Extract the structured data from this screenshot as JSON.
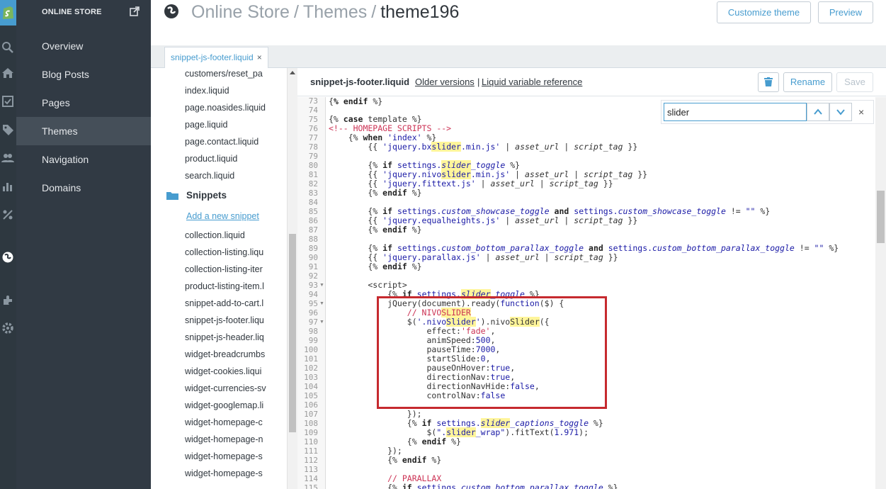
{
  "colors": {
    "accent": "#479ccf",
    "nav_bg": "#313a44",
    "rail_bg": "#2e3840",
    "highlight_box": "#c62a2f"
  },
  "nav": {
    "store_label": "ONLINE STORE",
    "items": [
      {
        "label": "Overview"
      },
      {
        "label": "Blog Posts"
      },
      {
        "label": "Pages"
      },
      {
        "label": "Themes",
        "active": true
      },
      {
        "label": "Navigation"
      },
      {
        "label": "Domains"
      }
    ]
  },
  "rail_icons": [
    "shopify-logo-icon",
    "search-icon",
    "home-icon",
    "orders-icon",
    "tag-icon",
    "customers-icon",
    "reports-icon",
    "discounts-icon",
    "online-store-icon",
    "apps-icon",
    "settings-icon"
  ],
  "header": {
    "crumbs": [
      "Online Store",
      "Themes"
    ],
    "separator": "/",
    "current": "theme196",
    "customize_label": "Customize theme",
    "preview_label": "Preview"
  },
  "tab": {
    "label": "snippet-js-footer.liquid",
    "close": "×"
  },
  "tree": {
    "files_top": [
      "customers/reset_pa",
      "index.liquid",
      "page.noasides.liquid",
      "page.liquid",
      "page.contact.liquid",
      "product.liquid",
      "search.liquid"
    ],
    "snippets_label": "Snippets",
    "add_snippet": "Add a new snippet",
    "snippets": [
      "collection.liquid",
      "collection-listing.liqu",
      "collection-listing-iter",
      "product-listing-item.l",
      "snippet-add-to-cart.l",
      "snippet-js-footer.liqu",
      "snippet-js-header.liq",
      "widget-breadcrumbs",
      "widget-cookies.liqui",
      "widget-currencies-sv",
      "widget-googlemap.li",
      "widget-homepage-c",
      "widget-homepage-n",
      "widget-homepage-s",
      "widget-homepage-s"
    ]
  },
  "editor": {
    "filename": "snippet-js-footer.liquid",
    "older_versions": "Older versions",
    "pipe": "|",
    "liquid_ref": "Liquid variable reference",
    "rename_label": "Rename",
    "save_label": "Save",
    "search_value": "slider",
    "search_close": "×",
    "line_numbers": [
      73,
      74,
      75,
      76,
      77,
      78,
      79,
      80,
      81,
      82,
      83,
      84,
      85,
      86,
      87,
      88,
      89,
      90,
      91,
      92,
      93,
      94,
      95,
      96,
      97,
      98,
      99,
      100,
      101,
      102,
      103,
      104,
      105,
      106,
      107,
      108,
      109,
      110,
      111,
      112,
      113,
      114,
      115
    ]
  }
}
